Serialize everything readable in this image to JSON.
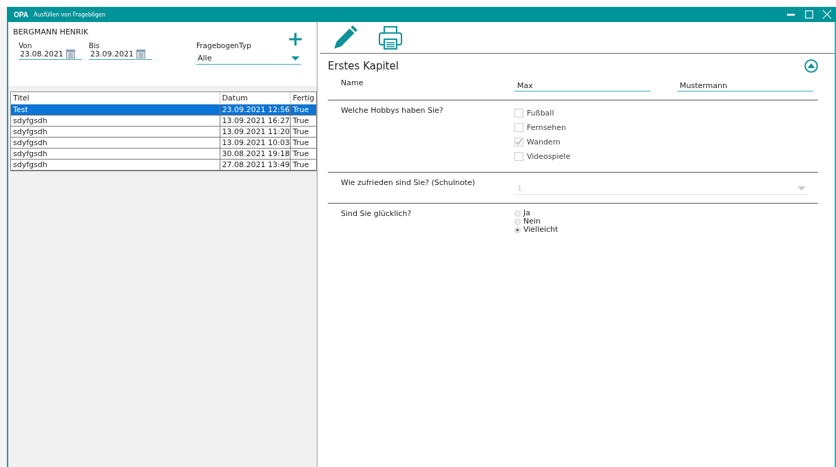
{
  "title_bar": {
    "logo": "OPA",
    "title": "Ausfüllen von Fragebögen"
  },
  "left": {
    "patient": "BERGMANN HENRIK",
    "von": {
      "label": "Von",
      "value": "23.08.2021"
    },
    "bis": {
      "label": "Bis",
      "value": "23.09.2021"
    },
    "typ": {
      "label": "FragebogenTyp",
      "value": "Alle"
    },
    "table": {
      "columns": [
        "Titel",
        "Datum",
        "Fertig"
      ],
      "rows": [
        {
          "cells": [
            "Test",
            "23.09.2021 12:56",
            "True"
          ],
          "selected": true
        },
        {
          "cells": [
            "sdyfgsdh",
            "13.09.2021 16:27",
            "True"
          ],
          "selected": false
        },
        {
          "cells": [
            "sdyfgsdh",
            "13.09.2021 11:20",
            "True"
          ],
          "selected": false
        },
        {
          "cells": [
            "sdyfgsdh",
            "13.09.2021 10:03",
            "True"
          ],
          "selected": false
        },
        {
          "cells": [
            "sdyfgsdh",
            "30.08.2021 19:18",
            "True"
          ],
          "selected": false
        },
        {
          "cells": [
            "sdyfgsdh",
            "27.08.2021 13:49",
            "True"
          ],
          "selected": false
        }
      ]
    }
  },
  "right": {
    "chapter": "Erstes Kapitel",
    "questions": [
      {
        "kind": "text",
        "label": "Name",
        "values": [
          "Max",
          "Mustermann"
        ]
      },
      {
        "kind": "checkbox",
        "label": "Welche Hobbys haben Sie?",
        "options": [
          {
            "label": "Fußball",
            "checked": false
          },
          {
            "label": "Fernsehen",
            "checked": false
          },
          {
            "label": "Wandern",
            "checked": true
          },
          {
            "label": "Videospiele",
            "checked": false
          }
        ]
      },
      {
        "kind": "dropdown",
        "label": "Wie zufrieden sind Sie? (Schulnote)",
        "value": "1",
        "disabled": true
      },
      {
        "kind": "radio",
        "label": "Sind Sie glücklich?",
        "options": [
          {
            "label": "Ja",
            "selected": false
          },
          {
            "label": "Nein",
            "selected": false
          },
          {
            "label": "Vielleicht",
            "selected": true
          }
        ]
      }
    ]
  }
}
